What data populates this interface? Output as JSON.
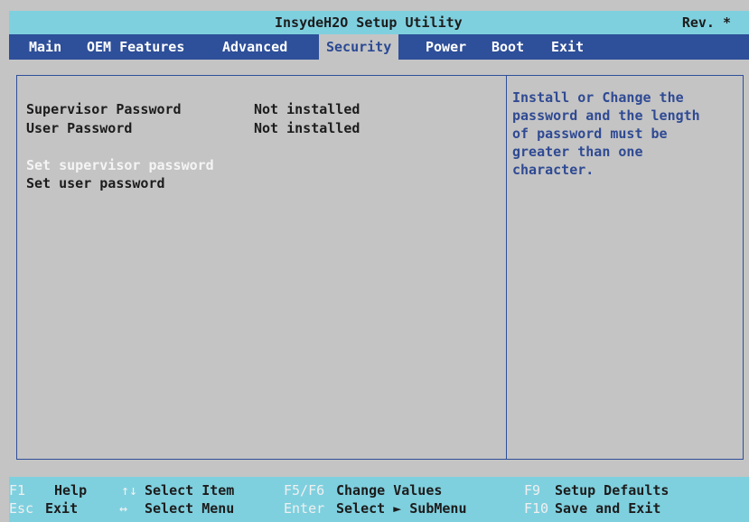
{
  "window": {
    "title": "InsydeH2O Setup Utility",
    "revision": "Rev. *"
  },
  "menu": [
    {
      "label": "Main"
    },
    {
      "label": "OEM Features"
    },
    {
      "label": "Advanced"
    },
    {
      "label": "Security",
      "active": true
    },
    {
      "label": "Power"
    },
    {
      "label": "Boot"
    },
    {
      "label": "Exit"
    }
  ],
  "security": {
    "items": [
      {
        "label": "Supervisor Password",
        "value": "Not installed"
      },
      {
        "label": "User Password",
        "value": "Not installed"
      }
    ],
    "actions": [
      {
        "label": "Set supervisor password",
        "selected": true
      },
      {
        "label": "Set user password"
      }
    ]
  },
  "help": {
    "text": "Install or Change the\npassword and the length\nof password must be\ngreater than one\ncharacter."
  },
  "footer": {
    "row1": [
      {
        "key": "F1",
        "action": "Help"
      },
      {
        "key": "↑↓",
        "action": "Select Item"
      },
      {
        "key": "F5/F6",
        "action": "Change Values"
      },
      {
        "key": "F9",
        "action": "Setup Defaults"
      }
    ],
    "row2": [
      {
        "key": "Esc",
        "action": "Exit"
      },
      {
        "key": "↔",
        "action": "Select Menu"
      },
      {
        "key": "Enter",
        "action": "Select ► SubMenu"
      },
      {
        "key": "F10",
        "action": "Save and Exit"
      }
    ]
  },
  "colors": {
    "title_bar": "#7fd0df",
    "menu_bar": "#2e4f99",
    "panel": "#c4c4c4",
    "help_text": "#2f4a93",
    "selected_text": "#f4f4f4"
  }
}
